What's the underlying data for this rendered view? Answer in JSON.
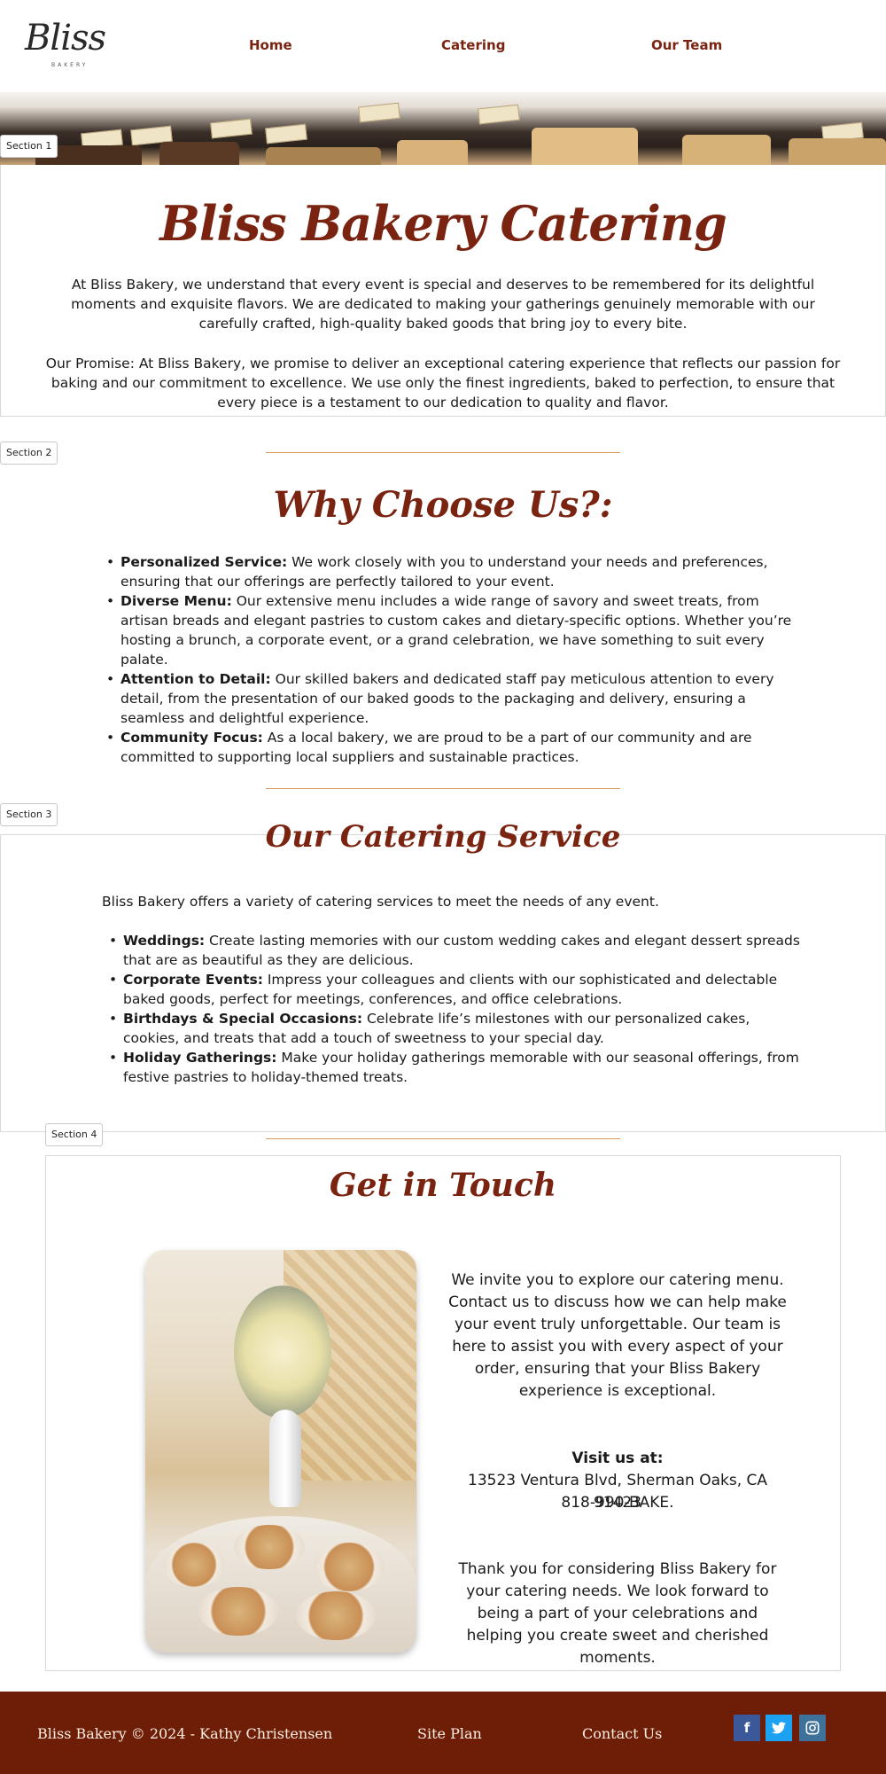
{
  "header": {
    "logo_text": "Bliss",
    "logo_subtext": "BAKERY",
    "nav": [
      "Home",
      "Catering",
      "Our Team"
    ]
  },
  "section_labels": [
    "Section 1",
    "Section 2",
    "Section 3",
    "Section 4"
  ],
  "section1": {
    "title": "Bliss Bakery Catering",
    "p1": "At Bliss Bakery, we understand that every event is special and deserves to be remembered for its delightful moments and exquisite flavors. We are dedicated to making your gatherings genuinely memorable with our carefully crafted, high-quality baked goods that bring joy to every bite.",
    "p2": "Our Promise: At Bliss Bakery, we promise to deliver an exceptional catering experience that reflects our passion for baking and our commitment to excellence. We use only the finest ingredients, baked to perfection, to ensure that every piece is a testament to our dedication to quality and flavor."
  },
  "section2": {
    "title": "Why Choose Us?:",
    "items": [
      {
        "label": "Personalized Service:",
        "text": " We work closely with you to understand your needs and preferences, ensuring that our offerings are perfectly tailored to your event."
      },
      {
        "label": "Diverse Menu:",
        "text": " Our extensive menu includes a wide range of savory and sweet treats, from artisan breads and elegant pastries to custom cakes and dietary-specific options. Whether you’re hosting a brunch, a corporate event, or a grand celebration, we have something to suit every palate."
      },
      {
        "label": "Attention to Detail:",
        "text": " Our skilled bakers and dedicated staff pay meticulous attention to every detail, from the presentation of our baked goods to the packaging and delivery, ensuring a seamless and delightful experience."
      },
      {
        "label": "Community Focus:",
        "text": " As a local bakery, we are proud to be a part of our community and are committed to supporting local suppliers and sustainable practices."
      }
    ]
  },
  "section3": {
    "title": "Our Catering Service",
    "intro": "Bliss Bakery offers a variety of catering services to meet the needs of any event.",
    "items": [
      {
        "label": "Weddings:",
        "text": " Create lasting memories with our custom wedding cakes and elegant dessert spreads that are as beautiful as they are delicious."
      },
      {
        "label": "Corporate Events:",
        "text": " Impress your colleagues and clients with our sophisticated and delectable baked goods, perfect for meetings, conferences, and office celebrations."
      },
      {
        "label": "Birthdays & Special Occasions:",
        "text": " Celebrate life’s milestones with our personalized cakes, cookies, and treats that add a touch of sweetness to your special day."
      },
      {
        "label": "Holiday Gatherings:",
        "text": " Make your holiday gatherings memorable with our seasonal offerings, from festive pastries to holiday-themed treats."
      }
    ]
  },
  "section4": {
    "title": "Get in Touch",
    "invite": "We invite you to explore our catering menu. Contact us to discuss how we can help make your event truly unforgettable. Our team is here to assist you with every aspect of your order, ensuring that your Bliss Bakery experience is exceptional.",
    "visit_label": "Visit us at:",
    "address": "13523 Ventura Blvd, Sherman Oaks, CA 91423",
    "phone": "818-990-BAKE.",
    "thanks": "Thank you for considering Bliss Bakery for your catering needs. We look forward to being a part of your celebrations and helping you create sweet and cherished moments."
  },
  "footer": {
    "copyright": "Bliss Bakery © 2024 - Kathy Christensen",
    "site_plan": "Site Plan",
    "contact": "Contact Us",
    "social": [
      {
        "icon": "facebook-icon",
        "glyph": "f",
        "color": "#3b5998"
      },
      {
        "icon": "twitter-icon",
        "glyph": "t",
        "color": "#1da1f2"
      },
      {
        "icon": "instagram-icon",
        "glyph": "◘",
        "color": "#3f729b"
      }
    ]
  },
  "colors": {
    "accent": "#7a2310",
    "footer_bg": "#6e1e06",
    "divider": "#d99a5a"
  }
}
